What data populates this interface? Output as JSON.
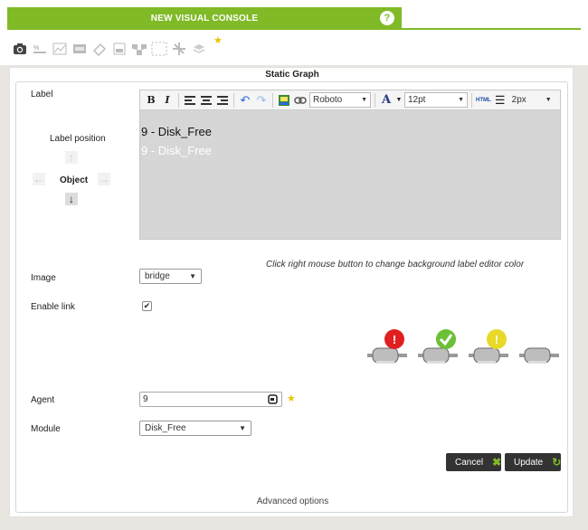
{
  "header": {
    "title": "NEW VISUAL CONSOLE",
    "help": "?"
  },
  "toolbar": {
    "icons": [
      "camera-icon",
      "percentile-icon",
      "module-graph-icon",
      "value-icon",
      "label-icon",
      "icon-element-icon",
      "network-link-icon",
      "box-icon",
      "line-icon",
      "group-icon"
    ],
    "star": "★"
  },
  "dialog": {
    "title": "Static Graph",
    "label_field": "Label",
    "label_position": "Label position",
    "object": "Object",
    "editor": {
      "font": "Roboto",
      "size": "12pt",
      "line_height": "2px",
      "line1": "9 - Disk_Free",
      "line2": "9 - Disk_Free",
      "html_label": "HTML"
    },
    "hint": "Click right mouse button to change background label editor color",
    "image_label": "Image",
    "image_value": "bridge",
    "enable_link_label": "Enable link",
    "enable_link_checked": "✔",
    "agent_label": "Agent",
    "agent_value": "9",
    "module_label": "Module",
    "module_value": "Disk_Free",
    "cancel": "Cancel",
    "update": "Update",
    "advanced": "Advanced options",
    "colors": {
      "accent": "#80ba27",
      "dark_button": "#333333",
      "red": "#e02020",
      "green": "#6cc035",
      "yellow": "#e8d828"
    }
  }
}
